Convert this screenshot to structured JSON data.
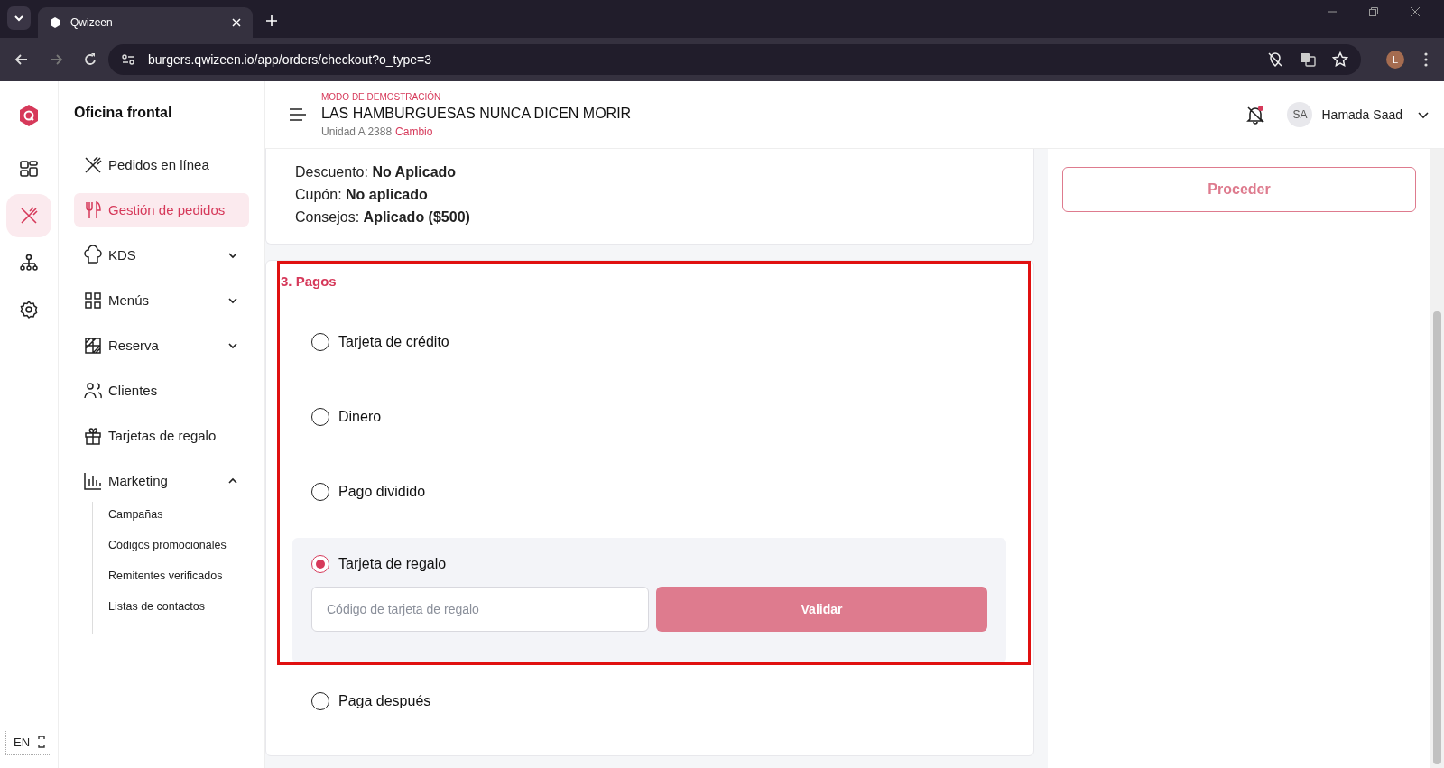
{
  "browser": {
    "tab_title": "Qwizeen",
    "url": "burgers.qwizeen.io/app/orders/checkout?o_type=3",
    "profile_initial": "L"
  },
  "rail": {
    "items": [
      {
        "kind": "dashboard",
        "selected": false
      },
      {
        "kind": "orders",
        "selected": true
      },
      {
        "kind": "network",
        "selected": false
      },
      {
        "kind": "settings",
        "selected": false
      }
    ],
    "language": "EN"
  },
  "sidebar": {
    "title": "Oficina frontal",
    "items": [
      {
        "kind": "link",
        "label": "Pedidos en línea",
        "selected": false
      },
      {
        "kind": "link",
        "label": "Gestión de pedidos",
        "selected": true
      },
      {
        "kind": "group",
        "label": "KDS",
        "selected": false,
        "expanded": false
      },
      {
        "kind": "group",
        "label": "Menús",
        "selected": false,
        "expanded": false
      },
      {
        "kind": "group",
        "label": "Reserva",
        "selected": false,
        "expanded": false
      },
      {
        "kind": "link",
        "label": "Clientes",
        "selected": false
      },
      {
        "kind": "link",
        "label": "Tarjetas de regalo",
        "selected": false
      },
      {
        "kind": "group",
        "label": "Marketing",
        "selected": false,
        "expanded": true,
        "children": [
          {
            "label": "Campañas"
          },
          {
            "label": "Códigos promocionales"
          },
          {
            "label": "Remitentes verificados"
          },
          {
            "label": "Listas de contactos"
          }
        ]
      }
    ]
  },
  "header": {
    "demo_label": "MODO DE DEMOSTRACIÓN",
    "store_name": "LAS HAMBURGUESAS NUNCA DICEN MORIR",
    "unit": "Unidad A 2388",
    "change_link": "Cambio",
    "user_initials": "SA",
    "user_name": "Hamada Saad"
  },
  "summary": [
    "Descuento: **No Aplicado**",
    "Cupón: **No aplicado**",
    "Consejos: **Aplicado ($500)**"
  ],
  "payments": {
    "title": "3. Pagos",
    "options": [
      {
        "label": "Tarjeta de crédito",
        "selected": false
      },
      {
        "label": "Dinero",
        "selected": false
      },
      {
        "label": "Pago dividido",
        "selected": false
      },
      {
        "label": "Tarjeta de regalo",
        "selected": true,
        "code_field": {
          "placeholder": "Código de tarjeta de regalo"
        },
        "validate_button": "Validar"
      },
      {
        "label": "Paga después",
        "selected": false
      }
    ]
  },
  "proceed_button": "Proceder"
}
